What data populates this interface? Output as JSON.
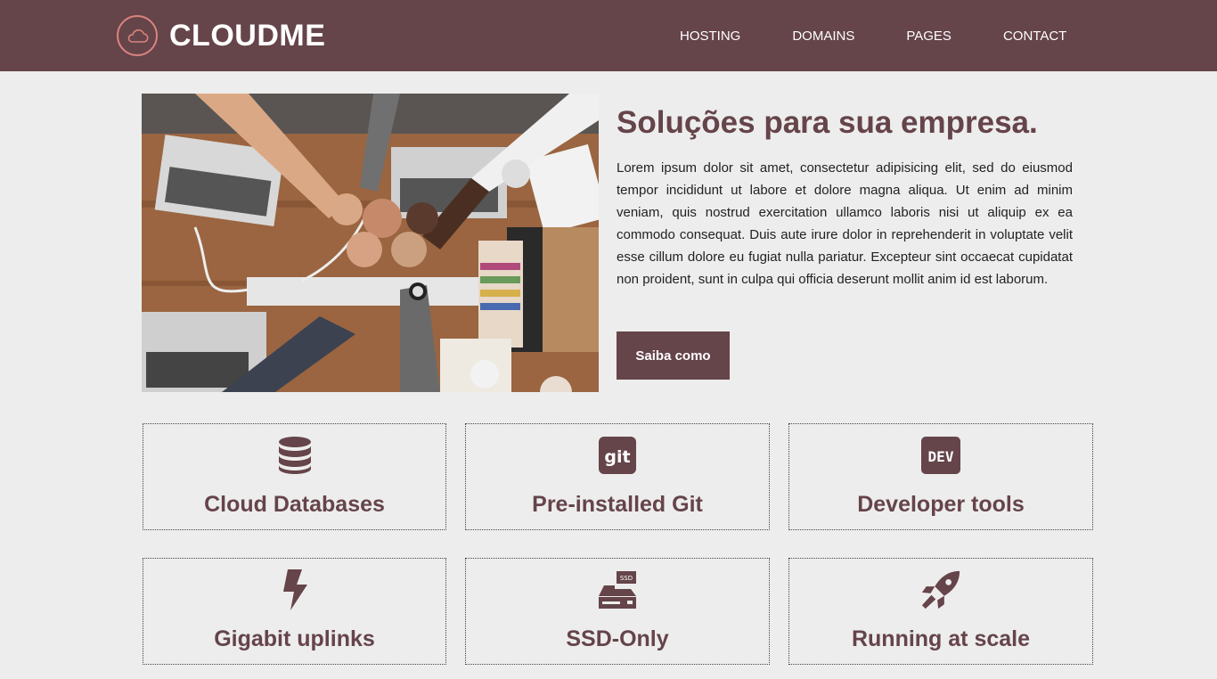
{
  "brand": {
    "name": "CLOUDME"
  },
  "nav": [
    {
      "label": "HOSTING"
    },
    {
      "label": "DOMAINS"
    },
    {
      "label": "PAGES"
    },
    {
      "label": "CONTACT"
    }
  ],
  "hero": {
    "title": "Soluções para sua empresa.",
    "text": "Lorem ipsum dolor sit amet, consectetur adipisicing elit, sed do eiusmod tempor incididunt ut labore et dolore magna aliqua. Ut enim ad minim veniam, quis nostrud exercitation ullamco laboris nisi ut aliquip ex ea commodo consequat. Duis aute irure dolor in reprehenderit in voluptate velit esse cillum dolore eu fugiat nulla pariatur. Excepteur sint occaecat cupidatat non proident, sunt in culpa qui officia deserunt mollit anim id est laborum.",
    "button": "Saiba como"
  },
  "features": [
    {
      "title": "Cloud Databases",
      "icon": "database-icon"
    },
    {
      "title": "Pre-installed Git",
      "icon": "git-icon",
      "icon_text": "git"
    },
    {
      "title": "Developer tools",
      "icon": "dev-icon",
      "icon_text": "DEV"
    },
    {
      "title": "Gigabit uplinks",
      "icon": "bolt-icon"
    },
    {
      "title": "SSD-Only",
      "icon": "ssd-icon",
      "icon_text": "SSD"
    },
    {
      "title": "Running at scale",
      "icon": "rocket-icon"
    }
  ],
  "colors": {
    "primary": "#65444a",
    "accent": "#d9837d",
    "background": "#ededed"
  }
}
